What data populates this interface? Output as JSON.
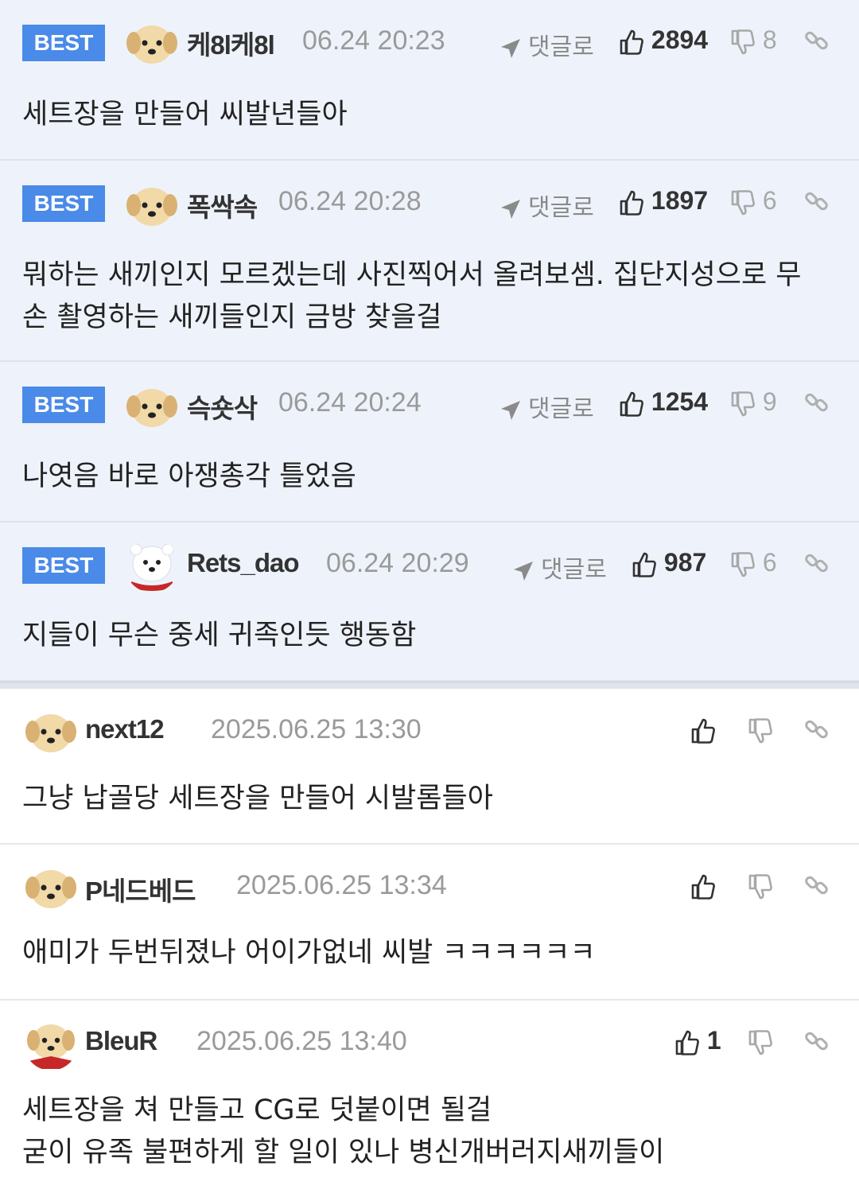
{
  "best_comments": [
    {
      "badge": "BEST",
      "nick": "케8l케8l",
      "date": "06.24 20:23",
      "reply_label": "댓글로",
      "likes": "2894",
      "dislikes": "8",
      "text": "세트장을 만들어 씨발년들아",
      "avatar": "puppy-avatar"
    },
    {
      "badge": "BEST",
      "nick": "폭싹속",
      "date": "06.24 20:28",
      "reply_label": "댓글로",
      "likes": "1897",
      "dislikes": "6",
      "text": "뭐하는 새끼인지 모르겠는데 사진찍어서 올려보셈. 집단지성으로 무손 촬영하는 새끼들인지 금방 찾을걸",
      "text_l1": "뭐하는 새끼인지 모르겠는데 사진찍어서 올려보셈. 집단지성으로 무",
      "text_l2": "손 촬영하는 새끼들인지 금방 찾을걸",
      "avatar": "puppy-avatar"
    },
    {
      "badge": "BEST",
      "nick": "슥숏삭",
      "date": "06.24 20:24",
      "reply_label": "댓글로",
      "likes": "1254",
      "dislikes": "9",
      "text": "나엿음 바로 아쟁총각 틀었음",
      "avatar": "puppy-avatar"
    },
    {
      "badge": "BEST",
      "nick": "Rets_dao",
      "date": "06.24 20:29",
      "reply_label": "댓글로",
      "likes": "987",
      "dislikes": "6",
      "text": "지들이 무슨 중세 귀족인듯 행동함",
      "avatar": "polar-bear-avatar"
    }
  ],
  "comments": [
    {
      "nick": "next12",
      "date": "2025.06.25 13:30",
      "likes": "",
      "text": "그냥 납골당 세트장을 만들어 시발롬들아",
      "avatar": "puppy-avatar"
    },
    {
      "nick": "P네드베드",
      "date": "2025.06.25 13:34",
      "likes": "",
      "text": "애미가 두번뒤졌나 어이가없네 씨발 ㅋㅋㅋㅋㅋㅋ",
      "avatar": "puppy-avatar"
    },
    {
      "nick": "BleuR",
      "date": "2025.06.25 13:40",
      "likes": "1",
      "text_l1": "세트장을 쳐 만들고 CG로 덧붙이면 될걸",
      "text_l2": "굳이 유족 불편하게 할 일이 있나 병신개버러지새끼들이",
      "avatar": "puppy-scarf-avatar"
    }
  ],
  "colors": {
    "best_bg": "#eef3fb",
    "badge": "#4a8ae8",
    "date": "#9a9a9a",
    "muted_icon": "#a8a8a8"
  }
}
